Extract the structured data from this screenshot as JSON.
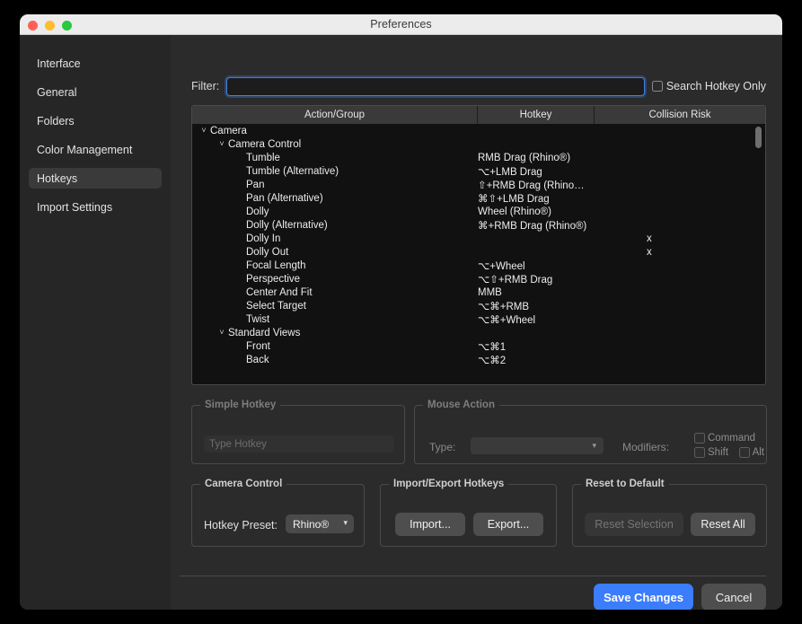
{
  "window": {
    "title": "Preferences",
    "traffic_lights": [
      "close",
      "minimize",
      "zoom"
    ]
  },
  "sidebar": {
    "items": [
      {
        "label": "Interface",
        "selected": false
      },
      {
        "label": "General",
        "selected": false
      },
      {
        "label": "Folders",
        "selected": false
      },
      {
        "label": "Color Management",
        "selected": false
      },
      {
        "label": "Hotkeys",
        "selected": true
      },
      {
        "label": "Import Settings",
        "selected": false
      }
    ]
  },
  "filter": {
    "label": "Filter:",
    "value": "",
    "placeholder": "",
    "search_hotkey_only_label": "Search Hotkey Only",
    "search_hotkey_only_checked": false
  },
  "table": {
    "columns": [
      "Action/Group",
      "Hotkey",
      "Collision Risk"
    ],
    "rows": [
      {
        "label": "Camera",
        "level": 0,
        "group": true,
        "expanded": true,
        "hotkey": "",
        "risk": ""
      },
      {
        "label": "Camera Control",
        "level": 1,
        "group": true,
        "expanded": true,
        "hotkey": "",
        "risk": ""
      },
      {
        "label": "Tumble",
        "level": 2,
        "group": false,
        "hotkey": "RMB Drag (Rhino®)",
        "risk": ""
      },
      {
        "label": "Tumble (Alternative)",
        "level": 2,
        "group": false,
        "hotkey": "⌥+LMB Drag",
        "risk": ""
      },
      {
        "label": "Pan",
        "level": 2,
        "group": false,
        "hotkey": "⇧+RMB Drag (Rhino…",
        "risk": ""
      },
      {
        "label": "Pan (Alternative)",
        "level": 2,
        "group": false,
        "hotkey": "⌘⇧+LMB Drag",
        "risk": ""
      },
      {
        "label": "Dolly",
        "level": 2,
        "group": false,
        "hotkey": "Wheel (Rhino®)",
        "risk": ""
      },
      {
        "label": "Dolly (Alternative)",
        "level": 2,
        "group": false,
        "hotkey": "⌘+RMB Drag (Rhino®)",
        "risk": ""
      },
      {
        "label": "Dolly In",
        "level": 2,
        "group": false,
        "hotkey": "",
        "risk": "x"
      },
      {
        "label": "Dolly Out",
        "level": 2,
        "group": false,
        "hotkey": "",
        "risk": "x"
      },
      {
        "label": "Focal Length",
        "level": 2,
        "group": false,
        "hotkey": "⌥+Wheel",
        "risk": ""
      },
      {
        "label": "Perspective",
        "level": 2,
        "group": false,
        "hotkey": "⌥⇧+RMB Drag",
        "risk": ""
      },
      {
        "label": "Center And Fit",
        "level": 2,
        "group": false,
        "hotkey": "MMB",
        "risk": ""
      },
      {
        "label": "Select Target",
        "level": 2,
        "group": false,
        "hotkey": "⌥⌘+RMB",
        "risk": ""
      },
      {
        "label": "Twist",
        "level": 2,
        "group": false,
        "hotkey": "⌥⌘+Wheel",
        "risk": ""
      },
      {
        "label": "Standard Views",
        "level": 1,
        "group": true,
        "expanded": true,
        "hotkey": "",
        "risk": ""
      },
      {
        "label": "Front",
        "level": 2,
        "group": false,
        "hotkey": "⌥⌘1",
        "risk": ""
      },
      {
        "label": "Back",
        "level": 2,
        "group": false,
        "hotkey": "⌥⌘2",
        "risk": ""
      }
    ]
  },
  "simple_hotkey": {
    "title": "Simple Hotkey",
    "field_placeholder": "Type Hotkey",
    "field_value": "",
    "enabled": false
  },
  "mouse_action": {
    "title": "Mouse Action",
    "type_label": "Type:",
    "type_value": "",
    "modifiers_label": "Modifiers:",
    "modifiers": [
      {
        "label": "Command",
        "checked": false
      },
      {
        "label": "Shift",
        "checked": false
      },
      {
        "label": "Alt",
        "checked": false
      }
    ],
    "enabled": false
  },
  "camera_control": {
    "title": "Camera Control",
    "preset_label": "Hotkey Preset:",
    "preset_value": "Rhino®"
  },
  "import_export": {
    "title": "Import/Export Hotkeys",
    "import_label": "Import...",
    "export_label": "Export..."
  },
  "reset": {
    "title": "Reset to Default",
    "reset_selection_label": "Reset Selection",
    "reset_selection_enabled": false,
    "reset_all_label": "Reset All",
    "reset_all_enabled": true
  },
  "footer": {
    "save_label": "Save Changes",
    "cancel_label": "Cancel"
  },
  "colors": {
    "accent": "#3b7dfb",
    "window_bg": "#2b2b2b",
    "sidebar_bg": "#262626",
    "table_bg": "#111111",
    "titlebar_bg": "#ececec"
  }
}
